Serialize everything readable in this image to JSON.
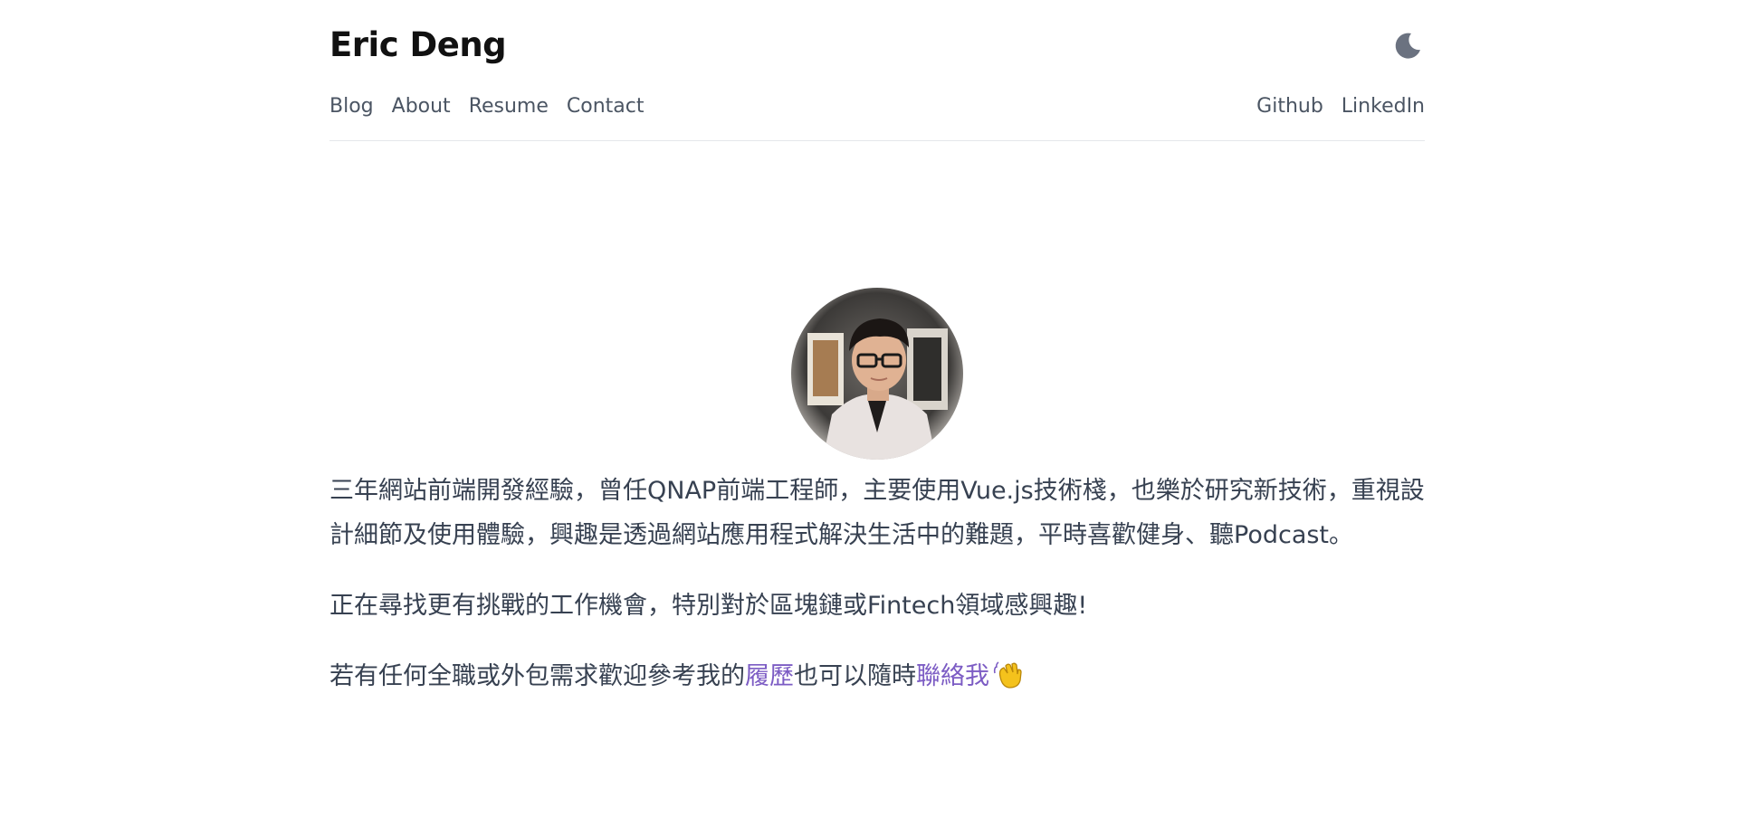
{
  "header": {
    "title": "Eric Deng",
    "theme_toggle_icon": "moon-icon"
  },
  "nav": {
    "left": [
      {
        "label": "Blog"
      },
      {
        "label": "About"
      },
      {
        "label": "Resume"
      },
      {
        "label": "Contact"
      }
    ],
    "right": [
      {
        "label": "Github"
      },
      {
        "label": "LinkedIn"
      }
    ]
  },
  "profile": {
    "avatar_icon": "profile-photo"
  },
  "bio": {
    "paragraph1": "三年網站前端開發經驗，曾任QNAP前端工程師，主要使用Vue.js技術棧，也樂於研究新技術，重視設計細節及使用體驗，興趣是透過網站應用程式解決生活中的難題，平時喜歡健身、聽Podcast。",
    "paragraph2": "正在尋找更有挑戰的工作機會，特別對於區塊鏈或Fintech領域感興趣!",
    "paragraph3_prefix": "若有任何全職或外包需求歡迎參考我的",
    "resume_link": "履歷",
    "paragraph3_middle": "也可以隨時",
    "contact_link": "聯絡我",
    "wave_icon": "waving-hand-icon"
  },
  "colors": {
    "link": "#7c5cc4",
    "nav_text": "#4b5563",
    "divider": "#e5e7eb"
  }
}
